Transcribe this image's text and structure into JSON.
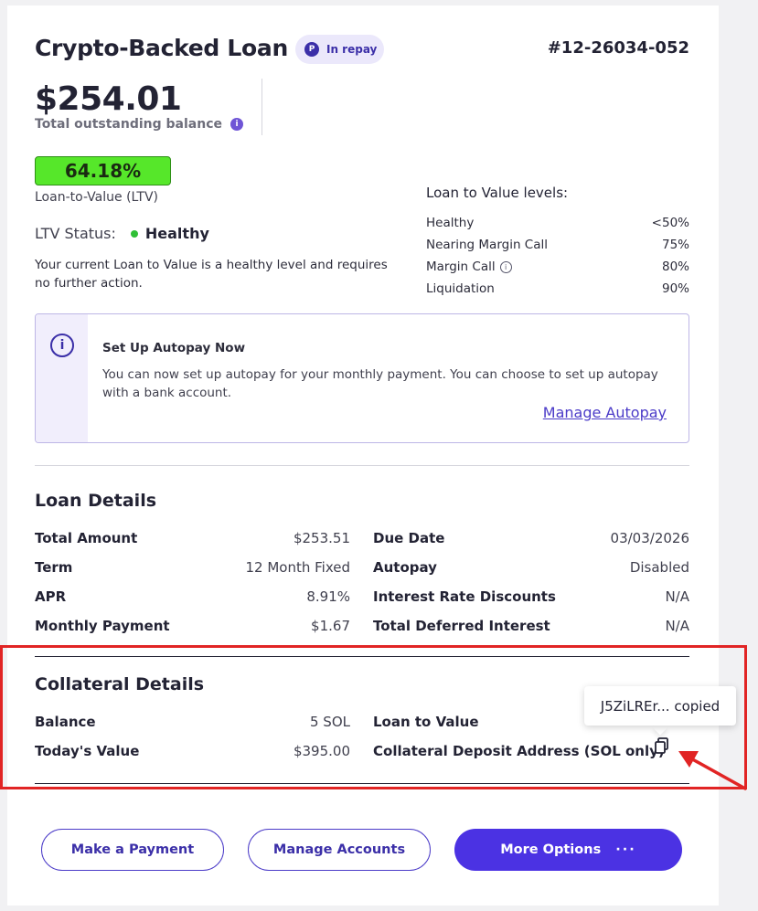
{
  "header": {
    "title": "Crypto-Backed Loan",
    "status_badge": "In repay",
    "loan_number": "#12-26034-052"
  },
  "balance": {
    "amount": "$254.01",
    "label": "Total outstanding balance"
  },
  "ltv": {
    "value": "64.18%",
    "label": "Loan-to-Value (LTV)",
    "status_label": "LTV Status:",
    "status_value": "Healthy",
    "status_color": "#2fbf35",
    "description": "Your current Loan to Value is a healthy level and requires no further action."
  },
  "levels": {
    "title": "Loan to Value levels:",
    "rows": [
      {
        "name": "Healthy",
        "value": "<50%"
      },
      {
        "name": "Nearing Margin Call",
        "value": "75%"
      },
      {
        "name": "Margin Call",
        "value": "80%"
      },
      {
        "name": "Liquidation",
        "value": "90%"
      }
    ]
  },
  "autopay": {
    "title": "Set Up Autopay Now",
    "body": "You can now set up autopay for your monthly payment. You can choose to set up autopay with a bank account.",
    "link": "Manage Autopay"
  },
  "loan_details": {
    "title": "Loan Details",
    "left": [
      {
        "key": "Total Amount",
        "value": "$253.51"
      },
      {
        "key": "Term",
        "value": "12 Month Fixed"
      },
      {
        "key": "APR",
        "value": "8.91%"
      },
      {
        "key": "Monthly Payment",
        "value": "$1.67"
      }
    ],
    "right": [
      {
        "key": "Due Date",
        "value": "03/03/2026"
      },
      {
        "key": "Autopay",
        "value": "Disabled"
      },
      {
        "key": "Interest Rate Discounts",
        "value": "N/A"
      },
      {
        "key": "Total Deferred Interest",
        "value": "N/A"
      }
    ]
  },
  "collateral": {
    "title": "Collateral Details",
    "left": [
      {
        "key": "Balance",
        "value": "5 SOL"
      },
      {
        "key": "Today's Value",
        "value": "$395.00"
      }
    ],
    "right": [
      {
        "key": "Loan to Value"
      },
      {
        "key": "Collateral Deposit Address (SOL only)"
      }
    ],
    "tooltip": "J5ZiLREr... copied"
  },
  "actions": {
    "make_payment": "Make a Payment",
    "manage_accounts": "Manage Accounts",
    "more_options": "More Options",
    "more_dots": "···"
  },
  "colors": {
    "accent": "#4b32e3",
    "ltv_green": "#56e72a",
    "highlight_red": "#e12424"
  }
}
